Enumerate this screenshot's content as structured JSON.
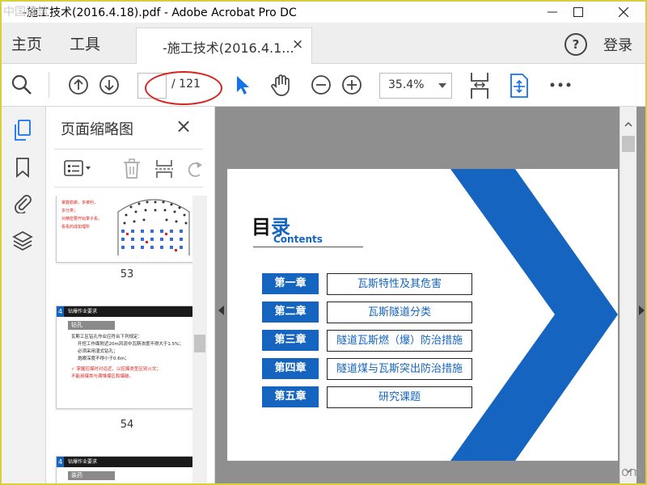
{
  "window": {
    "title": "-施工技术(2016.4.18).pdf - Adobe Acrobat Pro DC",
    "watermark": "中国建筑"
  },
  "menu": {
    "home": "主页",
    "tools": "工具",
    "tab_label": "-施工技术(2016.4.1...",
    "tab_close": "×",
    "help": "?",
    "login": "登录"
  },
  "toolbar": {
    "page_current": "",
    "page_total": "/ 121",
    "zoom": "35.4%"
  },
  "panel": {
    "title": "页面缩略图",
    "close": "×",
    "thumbnails": [
      {
        "num": "53"
      },
      {
        "num": "54"
      }
    ]
  },
  "thumb53": {
    "bullets": [
      "掌握稳跳，多被利，",
      "多分类；",
      "对精密要开始章子看，",
      "看看的成如理所"
    ]
  },
  "thumb54": {
    "header": "钻爆作业要求",
    "sub": "钻孔",
    "line1": "瓦斯工区钻孔作业应符合下列规定：",
    "b1": "开挖工作面附近20m风流中瓦斯浓度不得大于1.5%；",
    "b2": "必须采用湿式钻孔；",
    "b3": "炮眼深度不得小于0.6m；",
    "r1": "✓ 掌握控爆时对远近，以控爆类型区别火灾；",
    "r2": "不能用爆类与满堆爆区和爆破。"
  },
  "thumb55": {
    "header": "钻爆作业要求",
    "sub": "装药"
  },
  "slide": {
    "title_a": "目",
    "title_b": "录",
    "subtitle": "Contents",
    "chapters": [
      {
        "label": "第一章",
        "title": "瓦斯特性及其危害"
      },
      {
        "label": "第二章",
        "title": "瓦斯隧道分类"
      },
      {
        "label": "第三章",
        "title": "隧道瓦斯燃（爆）防治措施"
      },
      {
        "label": "第四章",
        "title": "隧道煤与瓦斯突出防治措施"
      },
      {
        "label": "第五章",
        "title": "研究课题"
      }
    ]
  },
  "corner_text": "om",
  "colors": {
    "accent_blue": "#1565c0",
    "annotation_red": "#d9231e",
    "toolbar_blue": "#1473e6"
  }
}
